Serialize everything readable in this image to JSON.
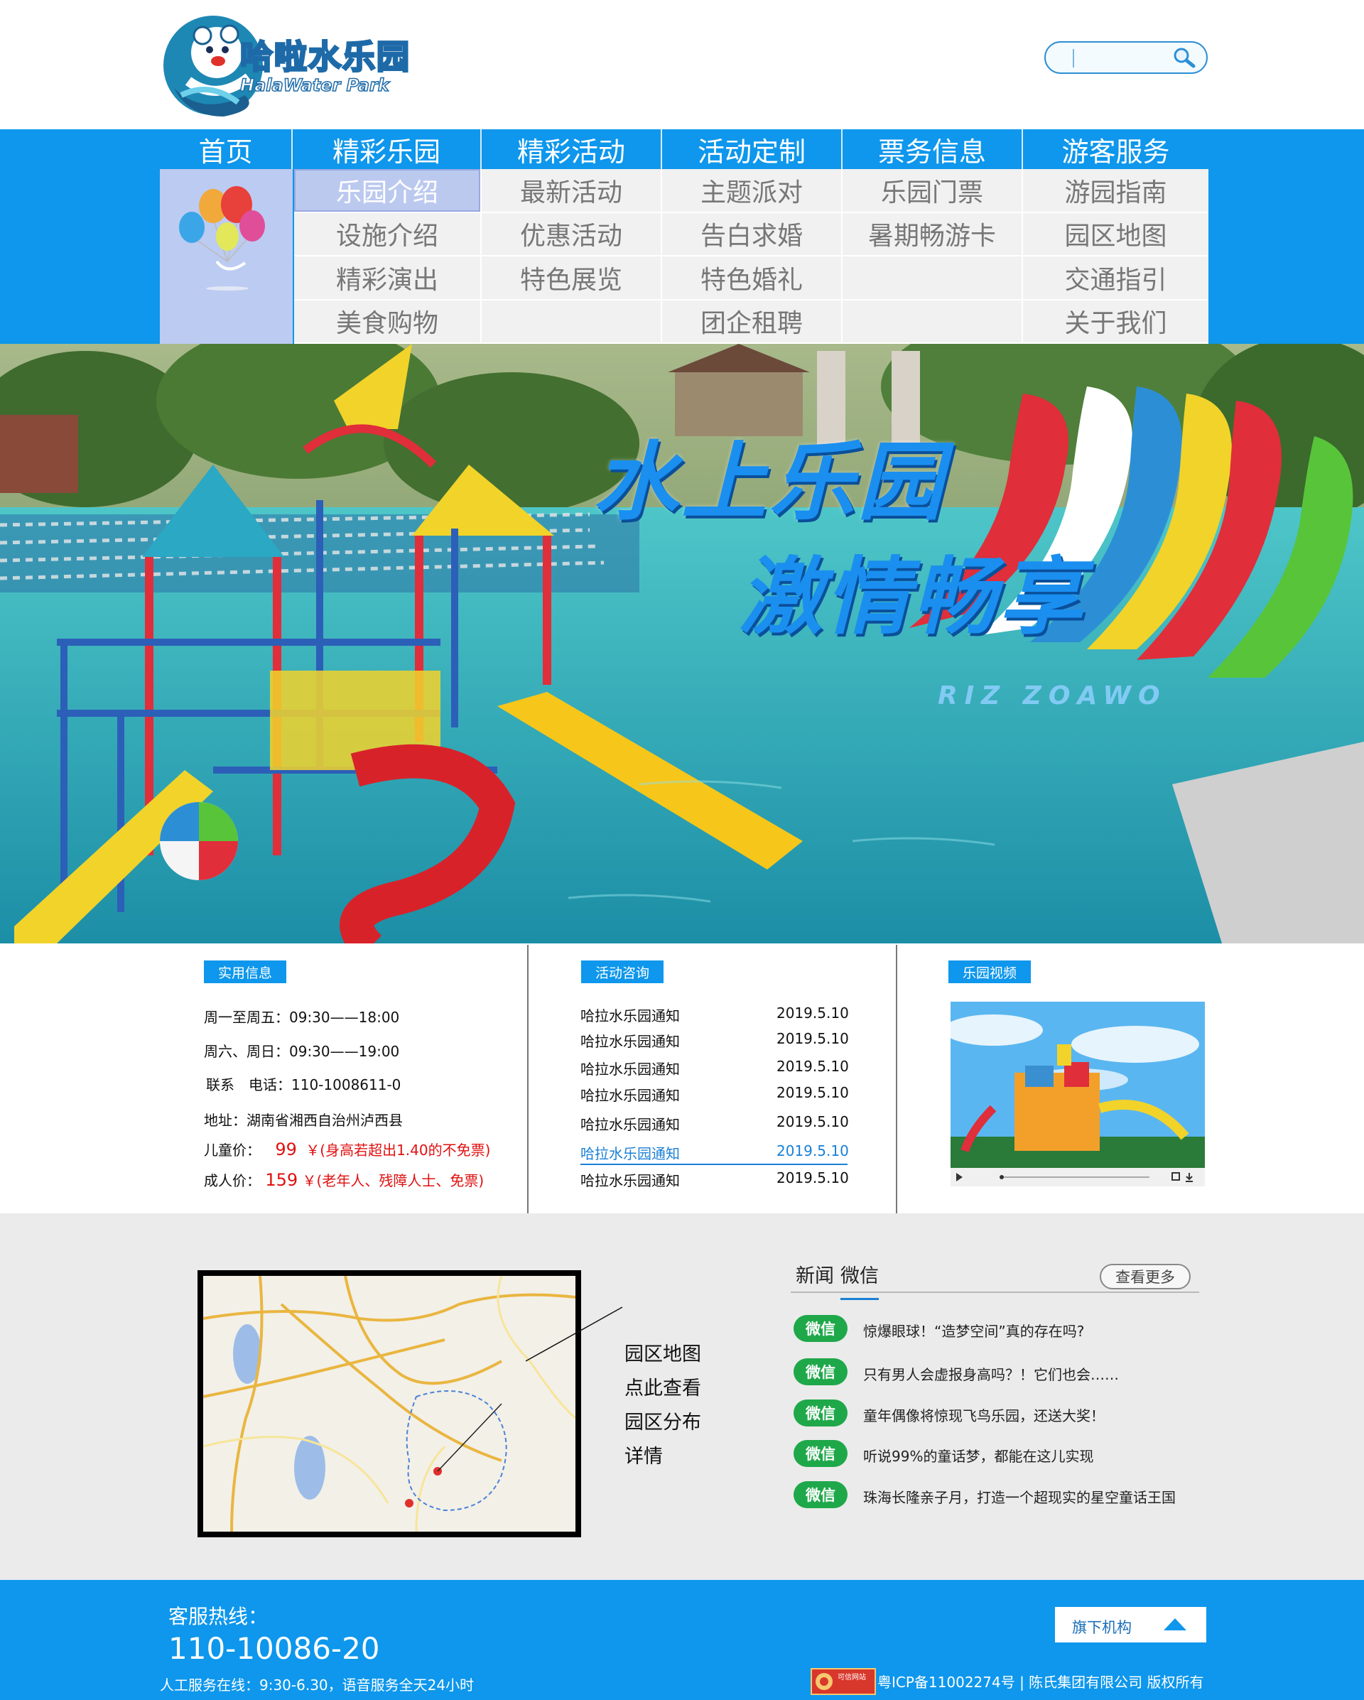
{
  "brand": {
    "logo_cn": "哈啦水乐园",
    "logo_en": "HalaWater Park"
  },
  "search": {
    "placeholder": ""
  },
  "nav": {
    "top": [
      "首页",
      "精彩乐园",
      "精彩活动",
      "活动定制",
      "票务信息",
      "游客服务"
    ],
    "columns": [
      [
        "乐园介绍",
        "设施介绍",
        "精彩演出",
        "美食购物"
      ],
      [
        "最新活动",
        "优惠活动",
        "特色展览",
        ""
      ],
      [
        "主题派对",
        "告白求婚",
        "特色婚礼",
        "团企租聘"
      ],
      [
        "乐园门票",
        "暑期畅游卡",
        "",
        ""
      ],
      [
        "游园指南",
        "园区地图",
        "交通指引",
        "关于我们"
      ]
    ]
  },
  "banner": {
    "title1": "水上乐园",
    "title2": "激情畅享",
    "subtitle": "RIZ ZOAWO"
  },
  "info": {
    "tag_practical": "实用信息",
    "hours_weekday": "周一至周五：09:30——18:00",
    "hours_weekend": "周六、周日：09:30——19:00",
    "contact": "联系　电话：110-1008611-0",
    "address": "地址：湖南省湘西自治州泸西县",
    "child_label": "儿童价：",
    "child_price": "99",
    "child_note": "￥(身高若超出1.40的不免票)",
    "adult_label": "成人价：",
    "adult_price": "159",
    "adult_note": "￥(老年人、残障人士、免票)",
    "tag_activity": "活动咨询",
    "news": [
      {
        "title": "哈拉水乐园通知",
        "date": "2019.5.10"
      },
      {
        "title": "哈拉水乐园通知",
        "date": "2019.5.10"
      },
      {
        "title": "哈拉水乐园通知",
        "date": "2019.5.10"
      },
      {
        "title": "哈拉水乐园通知",
        "date": "2019.5.10"
      },
      {
        "title": "哈拉水乐园通知",
        "date": "2019.5.10"
      },
      {
        "title": "哈拉水乐园通知",
        "date": "2019.5.10"
      },
      {
        "title": "哈拉水乐园通知",
        "date": "2019.5.10"
      }
    ],
    "tag_video": "乐园视频"
  },
  "map": {
    "caption": [
      "园区地图",
      "点此查看",
      "园区分布",
      "详情"
    ]
  },
  "feed": {
    "tabs": [
      "新闻",
      "微信"
    ],
    "more": "查看更多",
    "badge": "微信",
    "items": [
      "惊爆眼球！“造梦空间”真的存在吗?",
      "只有男人会虚报身高吗？！它们也会……",
      "童年偶像将惊现飞鸟乐园，还送大奖！",
      "听说99%的童话梦，都能在这儿实现",
      "珠海长隆亲子月，打造一个超现实的星空童话王国"
    ]
  },
  "footer": {
    "hotline_label": "客服热线：",
    "hotline": "110-10086-20",
    "service": "人工服务在线：9:30-6.30，语音服务全天24小时",
    "org": "旗下机构",
    "trust_badge": "可信网站",
    "icp": "粤ICP备11002274号 | 陈氏集团有限公司 版权所有"
  },
  "colors": {
    "primary": "#0e97ec",
    "wechat": "#1fa84a",
    "price": "#e01010",
    "nav_panel": "#bccbf1"
  }
}
